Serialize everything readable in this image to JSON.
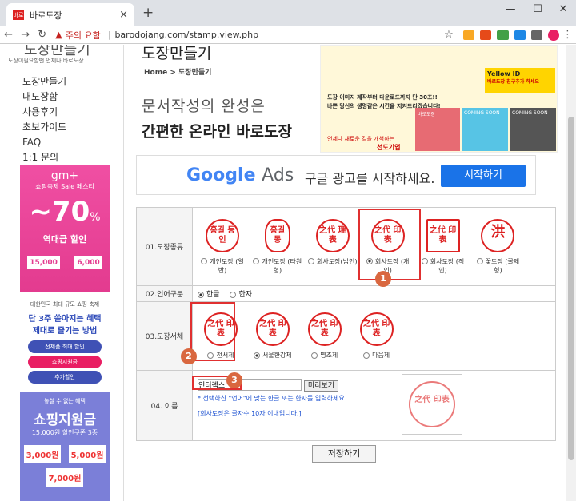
{
  "browser": {
    "tab_title": "바로도장",
    "url_warning": "주의 요함",
    "url": "barodojang.com/stamp.view.php",
    "favicon_text": "바로"
  },
  "sidebar": {
    "logo": "도장만들기",
    "logo_sub": "도장이필요할땐 언제나 바로도장",
    "menu": [
      "도장만들기",
      "내도장함",
      "사용후기",
      "초보가이드",
      "FAQ",
      "1:1 문의"
    ]
  },
  "ads": {
    "ad1_brand": "gm+",
    "ad1_line": "쇼핑축제 Sale 페스티",
    "ad1_percent": "~70",
    "ad1_unit": "%",
    "ad1_tag": "역대급 할인",
    "ad1_c1": "15,000",
    "ad1_c2": "6,000",
    "ad2_small": "대한민국 최대 규모 쇼핑 축제",
    "ad2_line1": "단 3주 쏟아지는 혜택",
    "ad2_line2": "제대로 즐기는 방법",
    "ad2_b1": "전제품 최대 할인",
    "ad2_b2": "쇼핑지원금",
    "ad2_b3": "추가할인",
    "ad3_small": "놓칠 수 없는 혜택",
    "ad3_title": "쇼핑지원금",
    "ad3_sub": "15,000원 할인쿠폰 3종",
    "ad3_c1": "3,000원",
    "ad3_c2": "5,000원",
    "ad3_c3": "7,000원"
  },
  "header": {
    "title": "도장만들기",
    "crumb_home": "Home",
    "crumb_sep": ">",
    "crumb_current": "도장만들기",
    "slogan1": "문서작성의 완성은",
    "slogan2": "간편한 온라인 바로도장"
  },
  "banner": {
    "line1": "도장 이미지 제작부터 다운로드까지 단 30초!!",
    "line2": "바쁜 당신의 생명같은 시간을 지켜드리겠습니다!",
    "yellow": "Yellow ID",
    "yellow_sub": "바로도장 친구추가 하세요",
    "tiles": [
      "바로도장",
      "COMING SOON",
      "COMING SOON"
    ],
    "footer": "언제나 새로운 길을 개척하는",
    "company": "선도기업"
  },
  "gads": {
    "google": "Google",
    "ads": "Ads",
    "text": "구글 광고를 시작하세요.",
    "button": "시작하기"
  },
  "form": {
    "row1_label": "01.도장종류",
    "types": [
      {
        "stamp": "홍길 동인",
        "label": "개인도장 (일반)"
      },
      {
        "stamp": "홍길 동",
        "label": "개인도장 (타원형)"
      },
      {
        "stamp": "之代 理表",
        "label": "회사도장(법인)"
      },
      {
        "stamp": "之代 印表",
        "label": "회사도장 (개인)"
      },
      {
        "stamp": "之代 印表",
        "label": "회사도장 (직인)"
      },
      {
        "stamp": "洪",
        "label": "꽃도장 (꿀제형)"
      }
    ],
    "row2_label": "02.언어구분",
    "lang": [
      "한글",
      "한자"
    ],
    "row3_label": "03.도장서체",
    "fonts": [
      "전서체",
      "서울한강체",
      "명조체",
      "다음체"
    ],
    "row4_label": "04. 이름",
    "name_value": "인터렉스",
    "preview_btn": "미리보기",
    "hint1": "* 선택하신 \"언어\"에 맞는 한글 또는 한자를 입력하세요.",
    "hint2": "[회사도장은 글자수 10자 이내입니다.]"
  },
  "save_button": "저장하기",
  "badges": [
    "1",
    "2",
    "3"
  ]
}
